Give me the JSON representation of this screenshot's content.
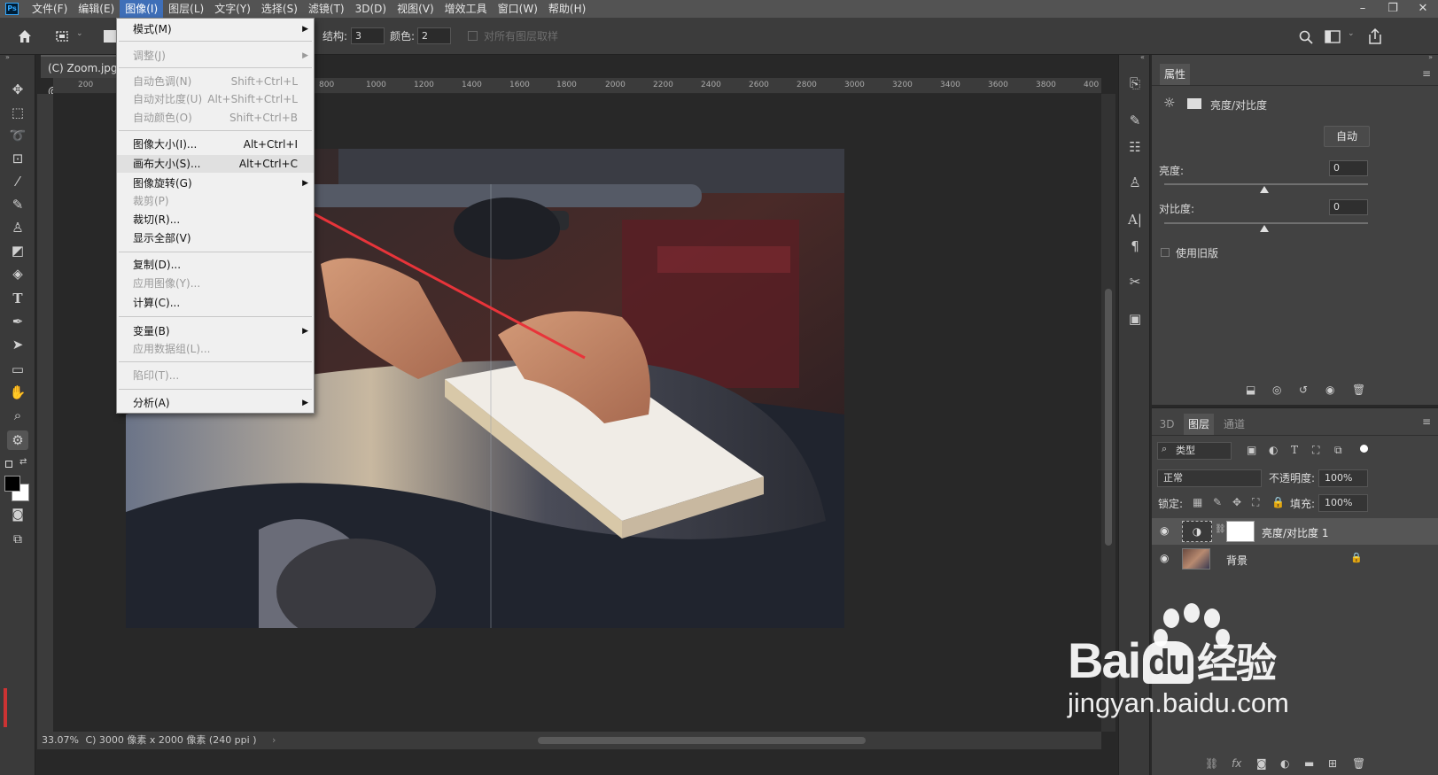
{
  "menubar": {
    "logo": "Ps",
    "items": [
      "文件(F)",
      "编辑(E)",
      "图像(I)",
      "图层(L)",
      "文字(Y)",
      "选择(S)",
      "滤镜(T)",
      "3D(D)",
      "视图(V)",
      "增效工具",
      "窗口(W)",
      "帮助(H)"
    ],
    "active": "图像(I)"
  },
  "options": {
    "structure_label": "结构:",
    "structure_value": "3",
    "color_label": "颜色:",
    "color_value": "2",
    "sample_all_label": "对所有图层取样"
  },
  "document": {
    "tab_title": "(C) Zoom.jpg @",
    "status_zoom": "33.07%",
    "status_info": "C) 3000 像素 x 2000 像素 (240 ppi )"
  },
  "ruler_top_ticks": [
    "200",
    "800",
    "1000",
    "1200",
    "1400",
    "1600",
    "1800",
    "2000",
    "2200",
    "2400",
    "2600",
    "2800",
    "3000",
    "3200",
    "3400",
    "3600",
    "3800",
    "400"
  ],
  "image_menu": {
    "items": [
      {
        "label": "模式(M)",
        "shortcut": "",
        "submenu": true,
        "disabled": false
      },
      {
        "label": "调整(J)",
        "shortcut": "",
        "submenu": true,
        "disabled": true
      },
      {
        "label": "自动色调(N)",
        "shortcut": "Shift+Ctrl+L",
        "submenu": false,
        "disabled": true
      },
      {
        "label": "自动对比度(U)",
        "shortcut": "Alt+Shift+Ctrl+L",
        "submenu": false,
        "disabled": true
      },
      {
        "label": "自动颜色(O)",
        "shortcut": "Shift+Ctrl+B",
        "submenu": false,
        "disabled": true
      },
      {
        "label": "图像大小(I)...",
        "shortcut": "Alt+Ctrl+I",
        "submenu": false,
        "disabled": false
      },
      {
        "label": "画布大小(S)...",
        "shortcut": "Alt+Ctrl+C",
        "submenu": false,
        "disabled": false
      },
      {
        "label": "图像旋转(G)",
        "shortcut": "",
        "submenu": true,
        "disabled": false
      },
      {
        "label": "裁剪(P)",
        "shortcut": "",
        "submenu": false,
        "disabled": true
      },
      {
        "label": "裁切(R)...",
        "shortcut": "",
        "submenu": false,
        "disabled": false
      },
      {
        "label": "显示全部(V)",
        "shortcut": "",
        "submenu": false,
        "disabled": false
      },
      {
        "label": "复制(D)...",
        "shortcut": "",
        "submenu": false,
        "disabled": false
      },
      {
        "label": "应用图像(Y)...",
        "shortcut": "",
        "submenu": false,
        "disabled": true
      },
      {
        "label": "计算(C)...",
        "shortcut": "",
        "submenu": false,
        "disabled": false
      },
      {
        "label": "变量(B)",
        "shortcut": "",
        "submenu": true,
        "disabled": false
      },
      {
        "label": "应用数据组(L)...",
        "shortcut": "",
        "submenu": false,
        "disabled": true
      },
      {
        "label": "陷印(T)...",
        "shortcut": "",
        "submenu": false,
        "disabled": true
      },
      {
        "label": "分析(A)",
        "shortcut": "",
        "submenu": true,
        "disabled": false
      }
    ]
  },
  "properties": {
    "tab": "属性",
    "adjustment_title": "亮度/对比度",
    "auto_button": "自动",
    "brightness_label": "亮度:",
    "brightness_value": "0",
    "contrast_label": "对比度:",
    "contrast_value": "0",
    "legacy_label": "使用旧版"
  },
  "layers_panel": {
    "tabs": [
      "3D",
      "图层",
      "通道"
    ],
    "active_tab": "图层",
    "filter_label": "类型",
    "blend_mode": "正常",
    "opacity_label": "不透明度:",
    "opacity_value": "100%",
    "lock_label": "锁定:",
    "fill_label": "填充:",
    "fill_value": "100%",
    "layers": [
      {
        "name": "亮度/对比度 1",
        "selected": true
      },
      {
        "name": "背景",
        "selected": false
      }
    ]
  },
  "watermark": {
    "brand_left": "Bai",
    "brand_mid": "du",
    "brand_right": "经验",
    "url": "jingyan.baidu.com"
  },
  "colors": {
    "accent_arrow": "#e8343a",
    "menu_active": "#3f6fb8"
  }
}
